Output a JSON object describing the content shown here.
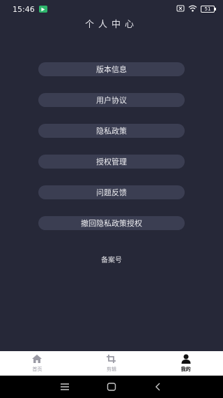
{
  "status": {
    "time": "15:46",
    "battery": "51"
  },
  "header": {
    "title": "个人中心"
  },
  "menu": {
    "items": [
      {
        "label": "版本信息"
      },
      {
        "label": "用户协议"
      },
      {
        "label": "隐私政策"
      },
      {
        "label": "授权管理"
      },
      {
        "label": "问题反馈"
      },
      {
        "label": "撤回隐私政策授权"
      }
    ]
  },
  "footer": {
    "beian": "备案号"
  },
  "tabs": [
    {
      "label": "首页",
      "icon": "home-icon"
    },
    {
      "label": "剪辑",
      "icon": "crop-icon"
    },
    {
      "label": "我的",
      "icon": "user-icon",
      "active": true
    }
  ],
  "colors": {
    "background": "#262838",
    "button": "#3b3e52",
    "tab_active": "#111111",
    "tab_inactive": "#9a9aa4"
  }
}
